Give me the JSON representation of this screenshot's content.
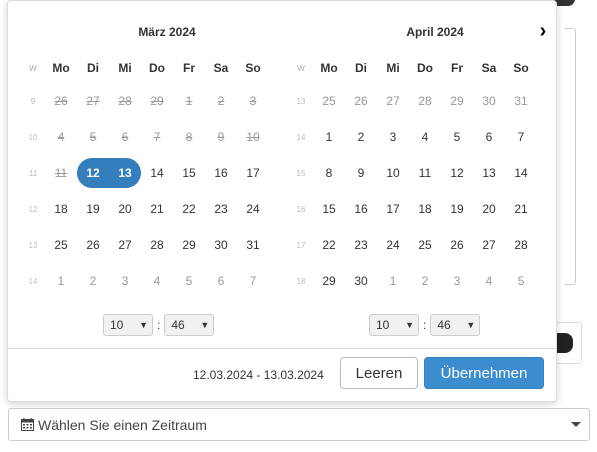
{
  "weekday_header": "W",
  "weekdays": [
    "Mo",
    "Di",
    "Mi",
    "Do",
    "Fr",
    "Sa",
    "So"
  ],
  "left_calendar": {
    "title": "März 2024",
    "weeks": [
      {
        "wk": "9",
        "days": [
          {
            "d": "26",
            "s": "disabled"
          },
          {
            "d": "27",
            "s": "disabled"
          },
          {
            "d": "28",
            "s": "disabled"
          },
          {
            "d": "29",
            "s": "disabled"
          },
          {
            "d": "1",
            "s": "disabled"
          },
          {
            "d": "2",
            "s": "disabled"
          },
          {
            "d": "3",
            "s": "disabled"
          }
        ]
      },
      {
        "wk": "10",
        "days": [
          {
            "d": "4",
            "s": "disabled"
          },
          {
            "d": "5",
            "s": "disabled"
          },
          {
            "d": "6",
            "s": "disabled"
          },
          {
            "d": "7",
            "s": "disabled"
          },
          {
            "d": "8",
            "s": "disabled"
          },
          {
            "d": "9",
            "s": "disabled"
          },
          {
            "d": "10",
            "s": "disabled"
          }
        ]
      },
      {
        "wk": "11",
        "days": [
          {
            "d": "11",
            "s": "disabled"
          },
          {
            "d": "12",
            "s": "sel-start"
          },
          {
            "d": "13",
            "s": "sel-end"
          },
          {
            "d": "14",
            "s": ""
          },
          {
            "d": "15",
            "s": ""
          },
          {
            "d": "16",
            "s": ""
          },
          {
            "d": "17",
            "s": ""
          }
        ]
      },
      {
        "wk": "12",
        "days": [
          {
            "d": "18",
            "s": ""
          },
          {
            "d": "19",
            "s": ""
          },
          {
            "d": "20",
            "s": ""
          },
          {
            "d": "21",
            "s": ""
          },
          {
            "d": "22",
            "s": ""
          },
          {
            "d": "23",
            "s": ""
          },
          {
            "d": "24",
            "s": ""
          }
        ]
      },
      {
        "wk": "13",
        "days": [
          {
            "d": "25",
            "s": ""
          },
          {
            "d": "26",
            "s": ""
          },
          {
            "d": "27",
            "s": ""
          },
          {
            "d": "28",
            "s": ""
          },
          {
            "d": "29",
            "s": ""
          },
          {
            "d": "30",
            "s": ""
          },
          {
            "d": "31",
            "s": ""
          }
        ]
      },
      {
        "wk": "14",
        "days": [
          {
            "d": "1",
            "s": "off"
          },
          {
            "d": "2",
            "s": "off"
          },
          {
            "d": "3",
            "s": "off"
          },
          {
            "d": "4",
            "s": "off"
          },
          {
            "d": "5",
            "s": "off"
          },
          {
            "d": "6",
            "s": "off"
          },
          {
            "d": "7",
            "s": "off"
          }
        ]
      }
    ],
    "hour": "10",
    "minute": "46"
  },
  "right_calendar": {
    "title": "April 2024",
    "weeks": [
      {
        "wk": "13",
        "days": [
          {
            "d": "25",
            "s": "off"
          },
          {
            "d": "26",
            "s": "off"
          },
          {
            "d": "27",
            "s": "off"
          },
          {
            "d": "28",
            "s": "off"
          },
          {
            "d": "29",
            "s": "off"
          },
          {
            "d": "30",
            "s": "off"
          },
          {
            "d": "31",
            "s": "off"
          }
        ]
      },
      {
        "wk": "14",
        "days": [
          {
            "d": "1",
            "s": ""
          },
          {
            "d": "2",
            "s": ""
          },
          {
            "d": "3",
            "s": ""
          },
          {
            "d": "4",
            "s": ""
          },
          {
            "d": "5",
            "s": ""
          },
          {
            "d": "6",
            "s": ""
          },
          {
            "d": "7",
            "s": ""
          }
        ]
      },
      {
        "wk": "15",
        "days": [
          {
            "d": "8",
            "s": ""
          },
          {
            "d": "9",
            "s": ""
          },
          {
            "d": "10",
            "s": ""
          },
          {
            "d": "11",
            "s": ""
          },
          {
            "d": "12",
            "s": ""
          },
          {
            "d": "13",
            "s": ""
          },
          {
            "d": "14",
            "s": ""
          }
        ]
      },
      {
        "wk": "16",
        "days": [
          {
            "d": "15",
            "s": ""
          },
          {
            "d": "16",
            "s": ""
          },
          {
            "d": "17",
            "s": ""
          },
          {
            "d": "18",
            "s": ""
          },
          {
            "d": "19",
            "s": ""
          },
          {
            "d": "20",
            "s": ""
          },
          {
            "d": "21",
            "s": ""
          }
        ]
      },
      {
        "wk": "17",
        "days": [
          {
            "d": "22",
            "s": ""
          },
          {
            "d": "23",
            "s": ""
          },
          {
            "d": "24",
            "s": ""
          },
          {
            "d": "25",
            "s": ""
          },
          {
            "d": "26",
            "s": ""
          },
          {
            "d": "27",
            "s": ""
          },
          {
            "d": "28",
            "s": ""
          }
        ]
      },
      {
        "wk": "18",
        "days": [
          {
            "d": "29",
            "s": ""
          },
          {
            "d": "30",
            "s": ""
          },
          {
            "d": "1",
            "s": "off"
          },
          {
            "d": "2",
            "s": "off"
          },
          {
            "d": "3",
            "s": "off"
          },
          {
            "d": "4",
            "s": "off"
          },
          {
            "d": "5",
            "s": "off"
          }
        ]
      }
    ],
    "hour": "10",
    "minute": "46"
  },
  "next_icon": "chevron-right-icon",
  "footer": {
    "range": "12.03.2024 - 13.03.2024",
    "clear_label": "Leeren",
    "apply_label": "Übernehmen"
  },
  "trigger": {
    "icon": "calendar-icon",
    "label": "Wählen Sie einen Zeitraum"
  },
  "colors": {
    "selected": "#357ebd",
    "apply_button": "#3c8dcf"
  }
}
